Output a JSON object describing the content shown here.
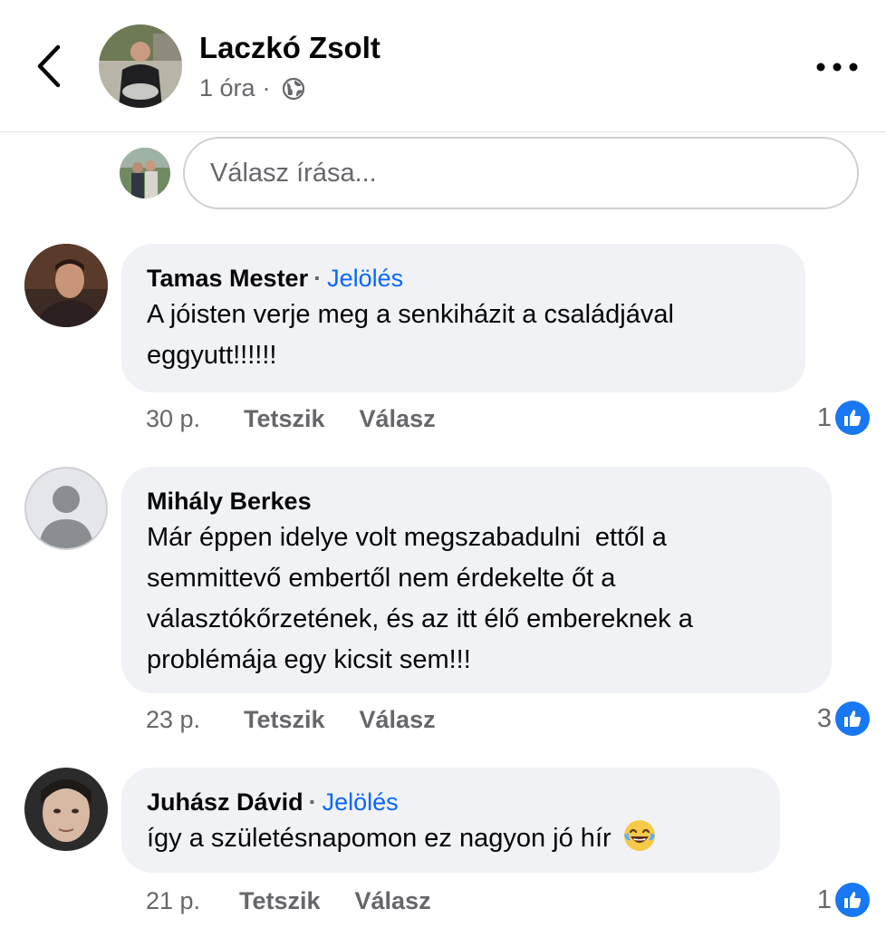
{
  "post": {
    "author": "Laczkó Zsolt",
    "time": "1 óra",
    "dot": "·",
    "audience_icon": "globe-icon"
  },
  "reply_box": {
    "placeholder": "Válasz írása..."
  },
  "comments": [
    {
      "author": "Tamas Mester",
      "separator": "·",
      "tag_label": "Jelölés",
      "text": "A jóisten verje meg a senkiházit a családjával eggyutt!!!!!!",
      "time": "30 p.",
      "like_label": "Tetszik",
      "reply_label": "Válasz",
      "reactions": "1"
    },
    {
      "author": "Mihály Berkes",
      "text": "Már éppen idelye volt megszabadulni  ettől a semmittevő embertől nem érdekelte őt a választókőrzetének, és az itt élő embereknek a problémája egy kicsit sem!!!",
      "time": "23 p.",
      "like_label": "Tetszik",
      "reply_label": "Válasz",
      "reactions": "3"
    },
    {
      "author": "Juhász Dávid",
      "separator": "·",
      "tag_label": "Jelölés",
      "text": "így a születésnapomon ez nagyon jó hír",
      "emoji": "laughing-crying-emoji",
      "time": "21 p.",
      "like_label": "Tetszik",
      "reply_label": "Válasz",
      "reactions": "1"
    }
  ],
  "colors": {
    "link_blue": "#0866ff",
    "like_blue": "#1877f2",
    "bubble": "#f0f2f5",
    "muted": "#65676b"
  }
}
